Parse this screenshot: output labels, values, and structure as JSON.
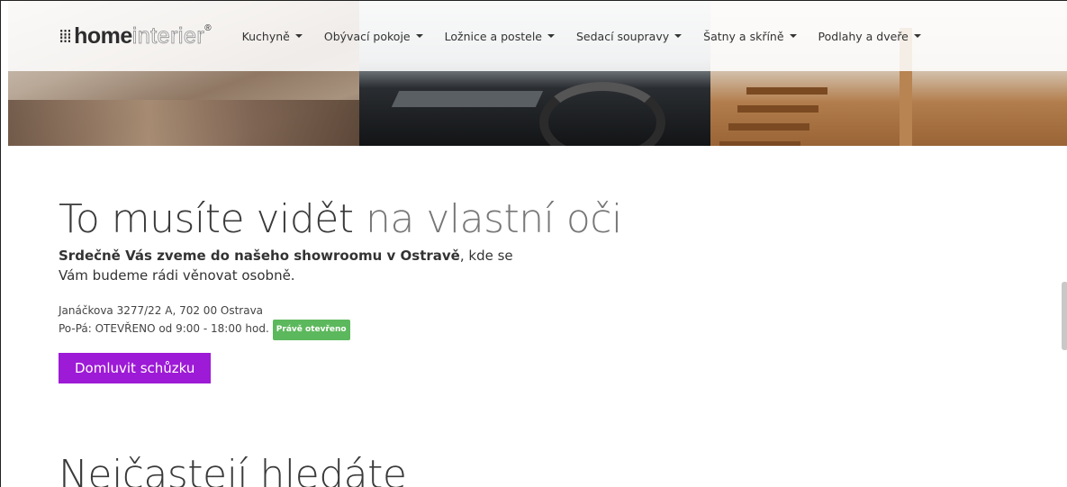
{
  "brand": {
    "logo_mark": "⁞⁞⁞",
    "logo_home": "home",
    "logo_interier": "interier",
    "logo_reg": "®"
  },
  "nav": {
    "items": [
      {
        "label": "Kuchyně"
      },
      {
        "label": "Obývací pokoje"
      },
      {
        "label": "Ložnice a postele"
      },
      {
        "label": "Sedací soupravy"
      },
      {
        "label": "Šatny a skříně"
      },
      {
        "label": "Podlahy a dveře"
      }
    ]
  },
  "showroom": {
    "headline_main": "To musíte vidět ",
    "headline_light": "na vlastní oči",
    "lead_bold": "Srdečně Vás zveme do našeho showroomu v Ostravě",
    "lead_rest": ", kde se Vám budeme rádi věnovat osobně.",
    "address": "Janáčkova 3277/22 A, 702 00 Ostrava",
    "hours": "Po-Pá: OTEVŘENO od 9:00 - 18:00 hod.",
    "open_badge": "Právě otevřeno",
    "cta_label": "Domluvit schůzku",
    "badge_color": "#5cb85c",
    "cta_color": "#9d1ad6"
  },
  "section": {
    "title": "Nejčastejí hledáte"
  }
}
